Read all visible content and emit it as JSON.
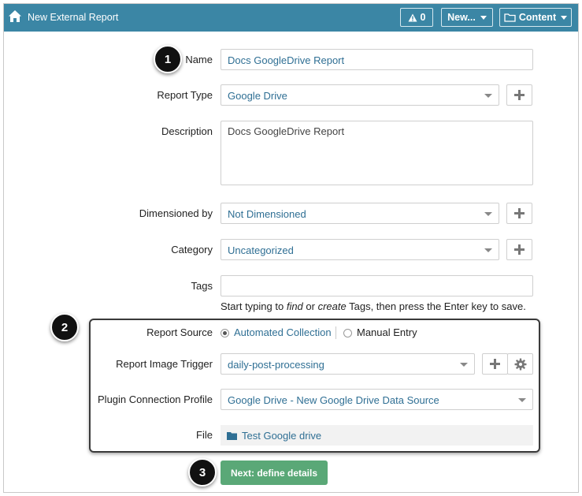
{
  "topbar": {
    "title": "New External Report",
    "alerts_count": "0",
    "new_label": "New...",
    "content_label": "Content",
    "color": "#3b86a5"
  },
  "form": {
    "name": {
      "label": "Name",
      "value": "Docs GoogleDrive Report"
    },
    "report_type": {
      "label": "Report Type",
      "value": "Google Drive"
    },
    "description": {
      "label": "Description",
      "value": "Docs GoogleDrive Report"
    },
    "dimensioned_by": {
      "label": "Dimensioned by",
      "value": "Not Dimensioned"
    },
    "category": {
      "label": "Category",
      "value": "Uncategorized"
    },
    "tags": {
      "label": "Tags",
      "value": "",
      "hint_prefix": "Start typing to ",
      "hint_find": "find",
      "hint_or": " or ",
      "hint_create": "create",
      "hint_suffix": " Tags, then press the Enter key to save."
    },
    "report_source": {
      "label": "Report Source",
      "option_automated": "Automated Collection",
      "option_manual": "Manual Entry",
      "selected": "Automated Collection"
    },
    "image_trigger": {
      "label": "Report Image Trigger",
      "value": "daily-post-processing"
    },
    "plugin_profile": {
      "label": "Plugin Connection Profile",
      "value": "Google Drive - New Google Drive Data Source"
    },
    "file": {
      "label": "File",
      "value": "Test Google drive"
    }
  },
  "next_button": {
    "label": "Next: define details",
    "color": "#5aa877"
  },
  "callouts": [
    "1",
    "2",
    "3"
  ],
  "icons": [
    "home-icon",
    "warning-icon",
    "folder-icon",
    "plus-icon",
    "gear-icon",
    "chevron-down-icon"
  ]
}
